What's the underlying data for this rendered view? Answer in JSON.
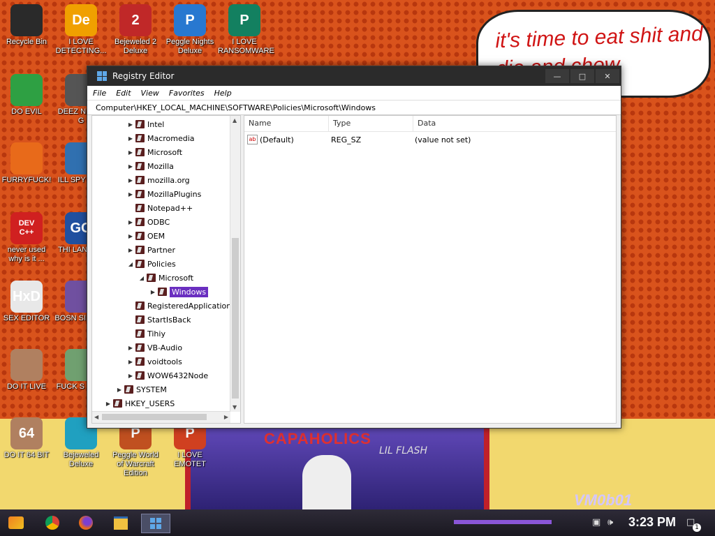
{
  "desktop": {
    "comic_text": "it's time to eat shit and die and chew",
    "poster_title": "CAPAHOLICS",
    "poster_subtitle": "LIL FLASH",
    "watermark": "VM0b01",
    "icons": [
      {
        "label": "Recycle Bin",
        "icon": "recycle-bin-icon",
        "glyph": "",
        "color": "#2a2a2a"
      },
      {
        "label": "I LOVE DETECTING...",
        "icon": "detect-it-easy-icon",
        "glyph": "De",
        "color": "#f0a000"
      },
      {
        "label": "Bejeweled 2 Deluxe",
        "icon": "bejeweled-2-icon",
        "glyph": "2",
        "color": "#c02828"
      },
      {
        "label": "Peggle Nights Deluxe",
        "icon": "peggle-nights-icon",
        "glyph": "P",
        "color": "#2878d0"
      },
      {
        "label": "I LOVE RANSOMWARE",
        "icon": "publisher-icon",
        "glyph": "P",
        "color": "#138060"
      },
      {
        "label": "DO EVIL",
        "icon": "chrome-icon",
        "glyph": "",
        "color": "#2ea043"
      },
      {
        "label": "DEEZ N HAH G",
        "icon": "file-icon",
        "glyph": "",
        "color": "#555555"
      },
      {
        "label": "FURRYFUCK!",
        "icon": "firefox-icon",
        "glyph": "",
        "color": "#e86a1a"
      },
      {
        "label": "ILL SPY YOU",
        "icon": "spy-icon",
        "glyph": "",
        "color": "#3070b0"
      },
      {
        "label": "never used why is it ...",
        "icon": "dev-cpp-icon",
        "glyph": "DEV C++",
        "color": "#d02020"
      },
      {
        "label": "THI LANGUA",
        "icon": "go-icon",
        "glyph": "GO",
        "color": "#2050a0"
      },
      {
        "label": "SEX EDITOR",
        "icon": "hxd-icon",
        "glyph": "HxD",
        "color": "#e8e8e8"
      },
      {
        "label": "BOSN SIMULA",
        "icon": "game-icon",
        "glyph": "",
        "color": "#7050a0"
      },
      {
        "label": "DO IT LIVE",
        "icon": "portrait-icon",
        "glyph": "",
        "color": "#b08060"
      },
      {
        "label": "FUCK S ELVE",
        "icon": "elf-icon",
        "glyph": "",
        "color": "#70a070"
      },
      {
        "label": "DO IT 64 BIT",
        "icon": "portrait-64-icon",
        "glyph": "64",
        "color": "#b08060"
      },
      {
        "label": "Bejeweled Deluxe",
        "icon": "bejeweled-icon",
        "glyph": "",
        "color": "#20a0c0"
      },
      {
        "label": "Peggle World of Warcraft Edition",
        "icon": "peggle-wow-icon",
        "glyph": "P",
        "color": "#c05020"
      },
      {
        "label": "I LOVE EMOTET",
        "icon": "powerpoint-icon",
        "glyph": "P",
        "color": "#d04020"
      }
    ]
  },
  "window": {
    "title": "Registry Editor",
    "menu": [
      "File",
      "Edit",
      "View",
      "Favorites",
      "Help"
    ],
    "address": "Computer\\HKEY_LOCAL_MACHINE\\SOFTWARE\\Policies\\Microsoft\\Windows",
    "tree": [
      {
        "label": "Intel",
        "level": 3,
        "arrow": "right"
      },
      {
        "label": "Macromedia",
        "level": 3,
        "arrow": "right"
      },
      {
        "label": "Microsoft",
        "level": 3,
        "arrow": "right"
      },
      {
        "label": "Mozilla",
        "level": 3,
        "arrow": "right"
      },
      {
        "label": "mozilla.org",
        "level": 3,
        "arrow": "right"
      },
      {
        "label": "MozillaPlugins",
        "level": 3,
        "arrow": "right"
      },
      {
        "label": "Notepad++",
        "level": 3,
        "arrow": "none"
      },
      {
        "label": "ODBC",
        "level": 3,
        "arrow": "right"
      },
      {
        "label": "OEM",
        "level": 3,
        "arrow": "right"
      },
      {
        "label": "Partner",
        "level": 3,
        "arrow": "right"
      },
      {
        "label": "Policies",
        "level": 3,
        "arrow": "down"
      },
      {
        "label": "Microsoft",
        "level": 4,
        "arrow": "down"
      },
      {
        "label": "Windows",
        "level": 5,
        "arrow": "right",
        "selected": true
      },
      {
        "label": "RegisteredApplications",
        "level": 3,
        "arrow": "none"
      },
      {
        "label": "StartIsBack",
        "level": 3,
        "arrow": "none"
      },
      {
        "label": "Tihiy",
        "level": 3,
        "arrow": "none"
      },
      {
        "label": "VB-Audio",
        "level": 3,
        "arrow": "right"
      },
      {
        "label": "voidtools",
        "level": 3,
        "arrow": "right"
      },
      {
        "label": "WOW6432Node",
        "level": 3,
        "arrow": "right"
      },
      {
        "label": "SYSTEM",
        "level": 2,
        "arrow": "right"
      },
      {
        "label": "HKEY_USERS",
        "level": 1,
        "arrow": "right"
      }
    ],
    "columns": [
      "Name",
      "Type",
      "Data"
    ],
    "values": [
      {
        "name": "(Default)",
        "type": "REG_SZ",
        "data": "(value not set)"
      }
    ]
  },
  "taskbar": {
    "time": "3:23 PM",
    "notification_count": "1",
    "items": [
      "start-menu-icon",
      "chrome-icon",
      "firefox-icon",
      "file-explorer-icon",
      "registry-editor-icon"
    ]
  }
}
